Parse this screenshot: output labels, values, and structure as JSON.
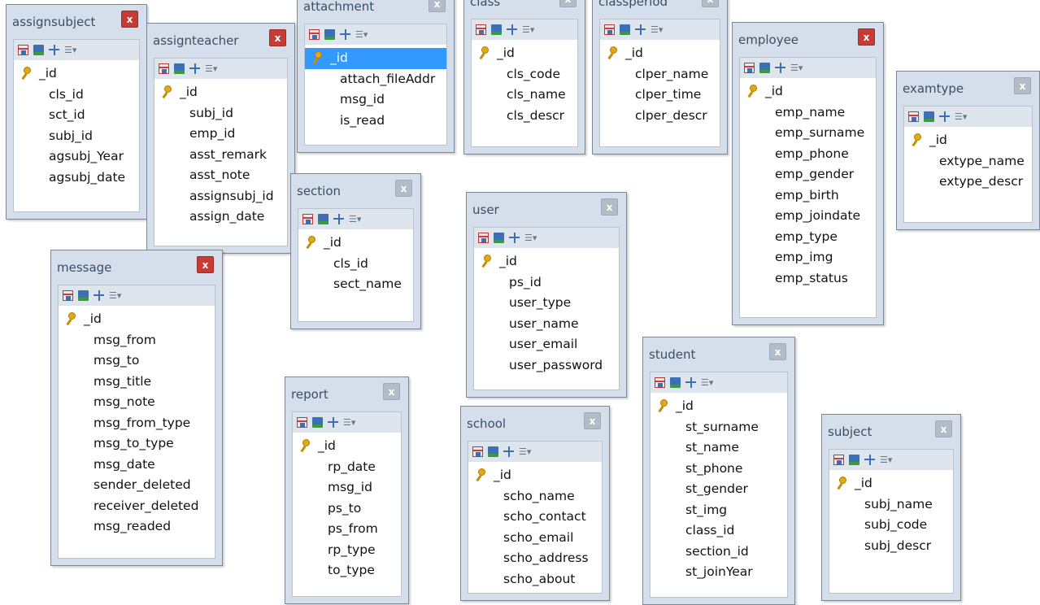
{
  "tables": [
    {
      "id": "assignsubject",
      "name": "assignsubject",
      "close_style": "red",
      "fields": [
        "_id",
        "cls_id",
        "sct_id",
        "subj_id",
        "agsubj_Year",
        "agsubj_date"
      ]
    },
    {
      "id": "assignteacher",
      "name": "assignteacher",
      "close_style": "red",
      "fields": [
        "_id",
        "subj_id",
        "emp_id",
        "asst_remark",
        "asst_note",
        "assignsubj_id",
        "assign_date"
      ]
    },
    {
      "id": "attachment",
      "name": "attachment",
      "close_style": "grey",
      "selected": 0,
      "fields": [
        "_id",
        "attach_fileAddr",
        "msg_id",
        "is_read"
      ]
    },
    {
      "id": "class",
      "name": "class",
      "close_style": "grey",
      "fields": [
        "_id",
        "cls_code",
        "cls_name",
        "cls_descr"
      ]
    },
    {
      "id": "classperiod",
      "name": "classperiod",
      "close_style": "grey",
      "fields": [
        "_id",
        "clper_name",
        "clper_time",
        "clper_descr"
      ]
    },
    {
      "id": "employee",
      "name": "employee",
      "close_style": "red",
      "fields": [
        "_id",
        "emp_name",
        "emp_surname",
        "emp_phone",
        "emp_gender",
        "emp_birth",
        "emp_joindate",
        "emp_type",
        "emp_img",
        "emp_status"
      ]
    },
    {
      "id": "examtype",
      "name": "examtype",
      "close_style": "grey",
      "fields": [
        "_id",
        "extype_name",
        "extype_descr"
      ]
    },
    {
      "id": "section",
      "name": "section",
      "close_style": "grey",
      "fields": [
        "_id",
        "cls_id",
        "sect_name"
      ]
    },
    {
      "id": "user",
      "name": "user",
      "close_style": "grey",
      "fields": [
        "_id",
        "ps_id",
        "user_type",
        "user_name",
        "user_email",
        "user_password"
      ]
    },
    {
      "id": "message",
      "name": "message",
      "close_style": "red",
      "fields": [
        "_id",
        "msg_from",
        "msg_to",
        "msg_title",
        "msg_note",
        "msg_from_type",
        "msg_to_type",
        "msg_date",
        "sender_deleted",
        "receiver_deleted",
        "msg_readed"
      ]
    },
    {
      "id": "report",
      "name": "report",
      "close_style": "grey",
      "fields": [
        "_id",
        "rp_date",
        "msg_id",
        "ps_to",
        "ps_from",
        "rp_type",
        "to_type"
      ]
    },
    {
      "id": "school",
      "name": "school",
      "close_style": "grey",
      "fields": [
        "_id",
        "scho_name",
        "scho_contact",
        "scho_email",
        "scho_address",
        "scho_about"
      ]
    },
    {
      "id": "student",
      "name": "student",
      "close_style": "grey",
      "fields": [
        "_id",
        "st_surname",
        "st_name",
        "st_phone",
        "st_gender",
        "st_img",
        "class_id",
        "section_id",
        "st_joinYear"
      ]
    },
    {
      "id": "subject",
      "name": "subject",
      "close_style": "grey",
      "fields": [
        "_id",
        "subj_name",
        "subj_code",
        "subj_descr"
      ]
    }
  ],
  "icons": {
    "close_glyph": "x",
    "toolbar": [
      "table-grid-icon",
      "save-icon",
      "relations-icon",
      "field-list-dropdown-icon"
    ],
    "primary_key": "key-icon"
  },
  "colors": {
    "window_frame": "#d5dfeb",
    "close_red": "#c43c35",
    "close_grey": "#b2bcc8",
    "selection": "#3399ff",
    "key": "#e2a818"
  }
}
